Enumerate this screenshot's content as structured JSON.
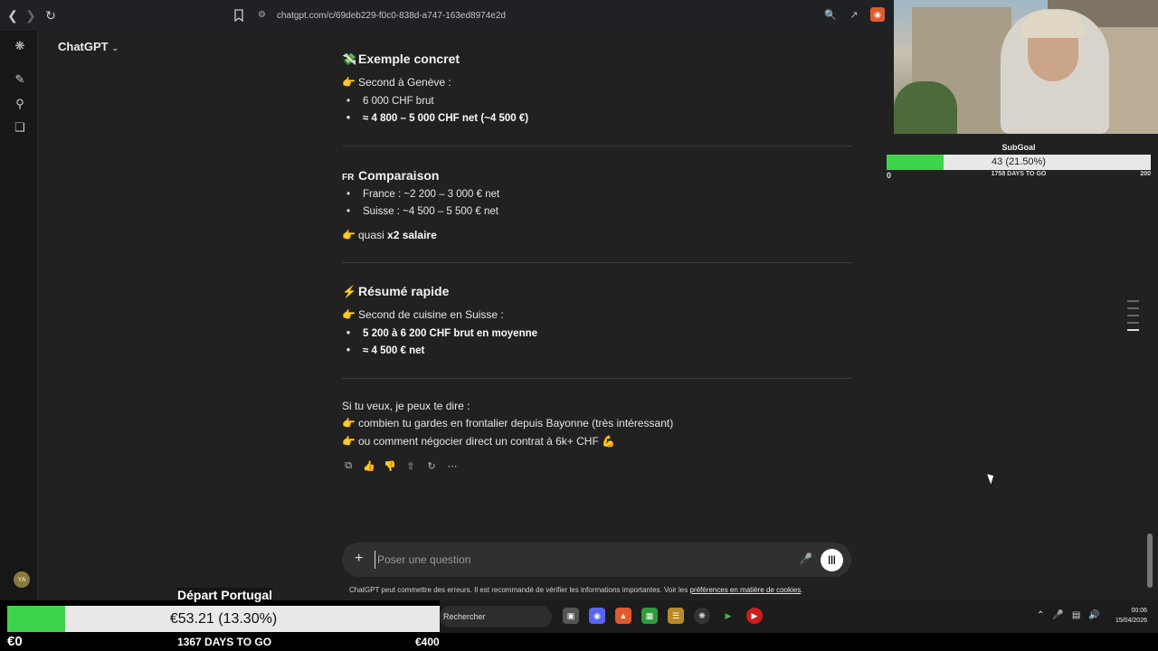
{
  "browser": {
    "url": "chatgpt.com/c/69deb229-f0c0-838d-a747-163ed8974e2d"
  },
  "app": {
    "model_label": "ChatGPT"
  },
  "sections": {
    "concrete": {
      "emoji": "💸",
      "title": "Exemple concret",
      "intro_emoji": "👉",
      "intro": "Second à Genève :",
      "bullet1": "6 000 CHF brut",
      "bullet2": "≈ 4 800 – 5 000 CHF net (~4 500 €)"
    },
    "compare": {
      "emoji": "FR",
      "title": "Comparaison",
      "bullet1": "France : ~2 200 – 3 000 € net",
      "bullet2": "Suisse : ~4 500 – 5 500 € net",
      "summary_emoji": "👉",
      "summary_prefix": "quasi",
      "summary_bold": "x2 salaire"
    },
    "summary": {
      "emoji": "⚡",
      "title": "Résumé rapide",
      "intro_emoji": "👉",
      "intro": "Second de cuisine en Suisse :",
      "bullet1": "5 200 à 6 200 CHF brut en moyenne",
      "bullet2": "≈ 4 500 € net"
    },
    "followup": {
      "intro": "Si tu veux, je peux te dire :",
      "item1_emoji": "👉",
      "item1": "combien tu gardes en frontalier depuis Bayonne (très intéressant)",
      "item2_emoji": "👉",
      "item2": "ou comment négocier direct un contrat à 6k+ CHF 💪"
    }
  },
  "composer": {
    "placeholder": "Poser une question",
    "disclaimer_prefix": "ChatGPT peut commettre des erreurs. Il est recommandé de vérifier les informations importantes. Voir les ",
    "disclaimer_link": "préférences en matière de cookies",
    "disclaimer_suffix": "."
  },
  "user": {
    "initials": "YA"
  },
  "subgoal": {
    "title": "SubGoal",
    "bar_text": "43 (21.50%)",
    "progress": 0.215,
    "min": "0",
    "days": "1758 DAYS TO GO",
    "max": "200"
  },
  "goal": {
    "title": "Départ Portugal",
    "bar_text": "€53.21 (13.30%)",
    "progress": 0.133,
    "min": "€0",
    "days": "1367 DAYS TO GO",
    "max": "€400"
  },
  "taskbar": {
    "search_label": "Rechercher",
    "time": "00:06",
    "date": "15/04/2026"
  },
  "colors": {
    "progress_green": "#3ed44c",
    "bg": "#212121"
  }
}
